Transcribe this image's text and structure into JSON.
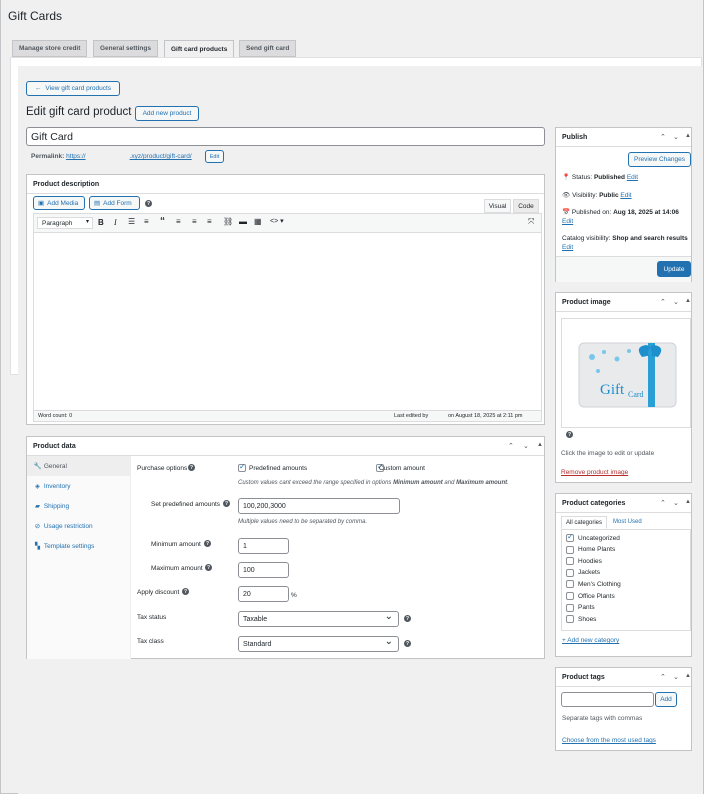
{
  "page": {
    "title": "Gift Cards",
    "heading": "Edit gift card product",
    "add_new": "Add new product",
    "back": "View gift card products"
  },
  "tabs": [
    "Manage store credit",
    "General settings",
    "Gift card products",
    "Send gift card"
  ],
  "product": {
    "title": "Gift Card",
    "permalink_label": "Permalink:",
    "permalink_prefix": "https://",
    "permalink_suffix": ".xyz/product/gift-card/",
    "permalink_edit": "Edit"
  },
  "editor": {
    "heading": "Product description",
    "add_media": "Add Media",
    "add_form": "Add Form",
    "visual": "Visual",
    "code": "Code",
    "format": "Paragraph",
    "word_count": "Word count: 0",
    "last_edited": "Last edited by",
    "last_edited_date": "on August 18, 2025 at 2:11 pm"
  },
  "product_data": {
    "heading": "Product data",
    "tabs": [
      "General",
      "Inventory",
      "Shipping",
      "Usage restriction",
      "Template settings"
    ],
    "purchase_options_label": "Purchase options",
    "predefined": "Predefined amounts",
    "custom": "Custom amount",
    "note_prefix": "Custom values cant exceed the range specified in options ",
    "note_min": "Minimum amount",
    "note_and": " and ",
    "note_max": "Maximum amount",
    "set_predefined_label": "Set predefined amounts",
    "set_predefined_value": "100,200,3000",
    "multiple_note": "Multiple values need to be separated by comma.",
    "min_label": "Minimum amount",
    "min_value": "1",
    "max_label": "Maximum amount",
    "max_value": "100",
    "discount_label": "Apply discount",
    "discount_value": "20",
    "percent": "%",
    "tax_status_label": "Tax status",
    "tax_status_value": "Taxable",
    "tax_class_label": "Tax class",
    "tax_class_value": "Standard"
  },
  "publish": {
    "heading": "Publish",
    "preview": "Preview Changes",
    "status_label": "Status:",
    "status": "Published",
    "visibility_label": "Visibility:",
    "visibility": "Public",
    "published_on_label": "Published on:",
    "published_on": "Aug 18, 2025 at 14:06",
    "catalog_label": "Catalog visibility:",
    "catalog": "Shop and search results",
    "edit": "Edit",
    "update": "Update"
  },
  "image": {
    "heading": "Product image",
    "hint": "Click the image to edit or update",
    "remove": "Remove product image",
    "card_text_big": "Gift",
    "card_text_small": "Card"
  },
  "categories": {
    "heading": "Product categories",
    "tab_all": "All categories",
    "tab_used": "Most Used",
    "items": [
      "Uncategorized",
      "Home Plants",
      "Hoodies",
      "Jackets",
      "Men's Clothing",
      "Office Plants",
      "Pants",
      "Shoes"
    ],
    "add": "+ Add new category"
  },
  "tags": {
    "heading": "Product tags",
    "add": "Add",
    "hint": "Separate tags with commas",
    "choose": "Choose from the most used tags"
  },
  "colors": {
    "accent": "#2271b1",
    "danger": "#b32d2e"
  }
}
